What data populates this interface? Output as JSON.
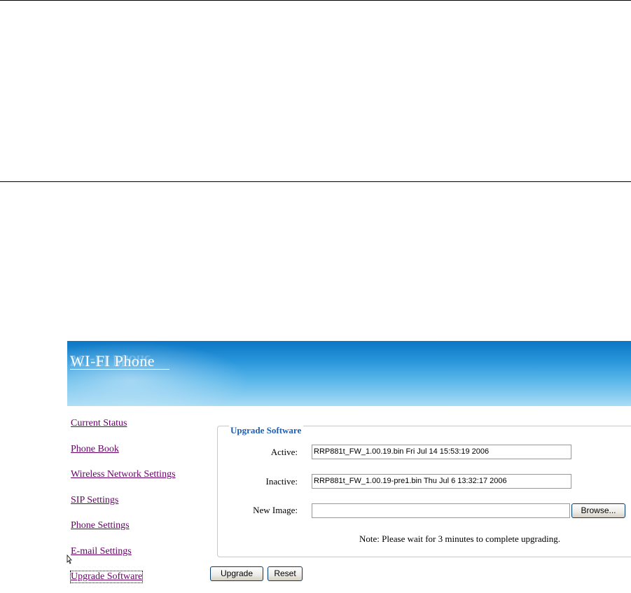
{
  "banner": {
    "title": "WI-FI Phone"
  },
  "nav": {
    "items": [
      {
        "label": "Current Status"
      },
      {
        "label": "Phone Book"
      },
      {
        "label": "Wireless Network Settings"
      },
      {
        "label": "SIP Settings"
      },
      {
        "label": "Phone Settings"
      },
      {
        "label": "E-mail Settings"
      },
      {
        "label": "Upgrade Software"
      }
    ],
    "active": "Upgrade Software"
  },
  "upgrade": {
    "legend": "Upgrade Software",
    "active_label": "Active:",
    "active_value": "RRP881t_FW_1.00.19.bin  Fri Jul 14 15:53:19 2006",
    "inactive_label": "Inactive:",
    "inactive_value": "RRP881t_FW_1.00.19-pre1.bin  Thu Jul  6 13:32:17 2006",
    "new_image_label": "New Image:",
    "new_image_value": "",
    "browse_label": "Browse...",
    "note": "Note: Please wait for 3 minutes to complete upgrading."
  },
  "actions": {
    "upgrade_label": "Upgrade",
    "reset_label": "Reset"
  },
  "colors": {
    "banner_top": "#0b76c4",
    "banner_bottom": "#a9dcf5",
    "link_visited": "#660066",
    "legend": "#1f5fb4"
  }
}
